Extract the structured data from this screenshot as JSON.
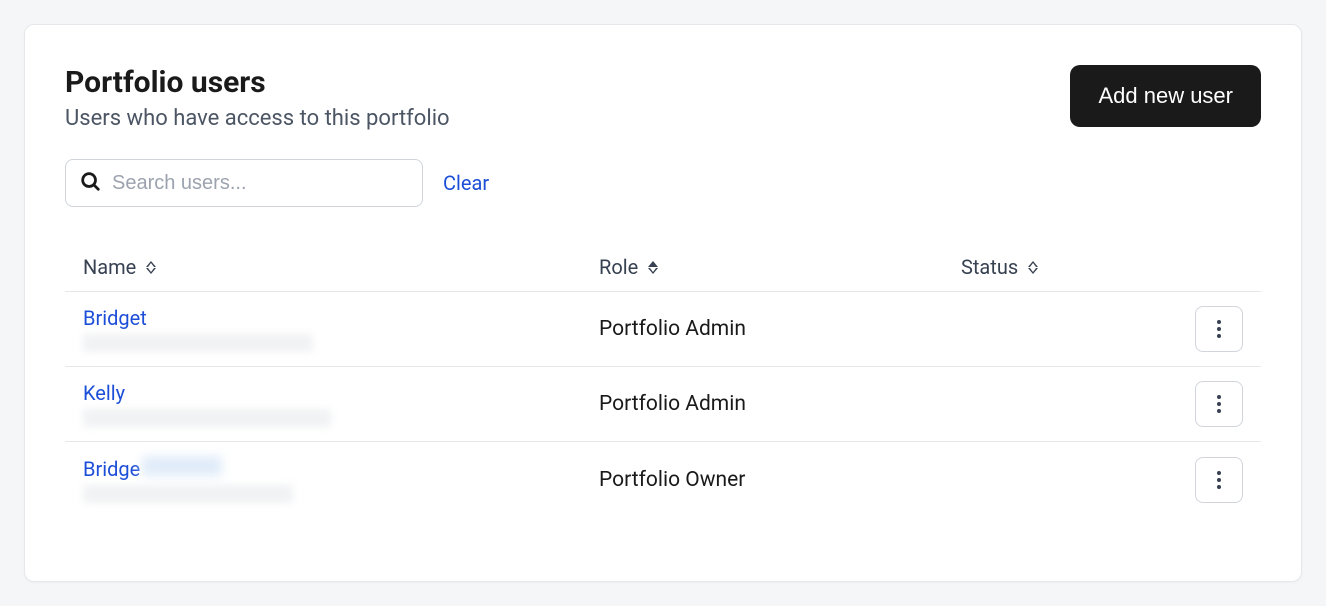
{
  "header": {
    "title": "Portfolio users",
    "subtitle": "Users who have access to this portfolio",
    "add_button": "Add new user"
  },
  "search": {
    "placeholder": "Search users...",
    "clear_label": "Clear"
  },
  "table": {
    "columns": {
      "name": "Name",
      "role": "Role",
      "status": "Status"
    },
    "sort": {
      "column": "role",
      "direction": "asc"
    },
    "rows": [
      {
        "name": "Bridget",
        "email_redacted_width": 230,
        "role": "Portfolio Admin",
        "status": ""
      },
      {
        "name": "Kelly",
        "email_redacted_width": 248,
        "role": "Portfolio Admin",
        "status": ""
      },
      {
        "name": "Bridge",
        "name_redacted_width": 80,
        "email_redacted_width": 210,
        "role": "Portfolio Owner",
        "status": ""
      }
    ]
  }
}
